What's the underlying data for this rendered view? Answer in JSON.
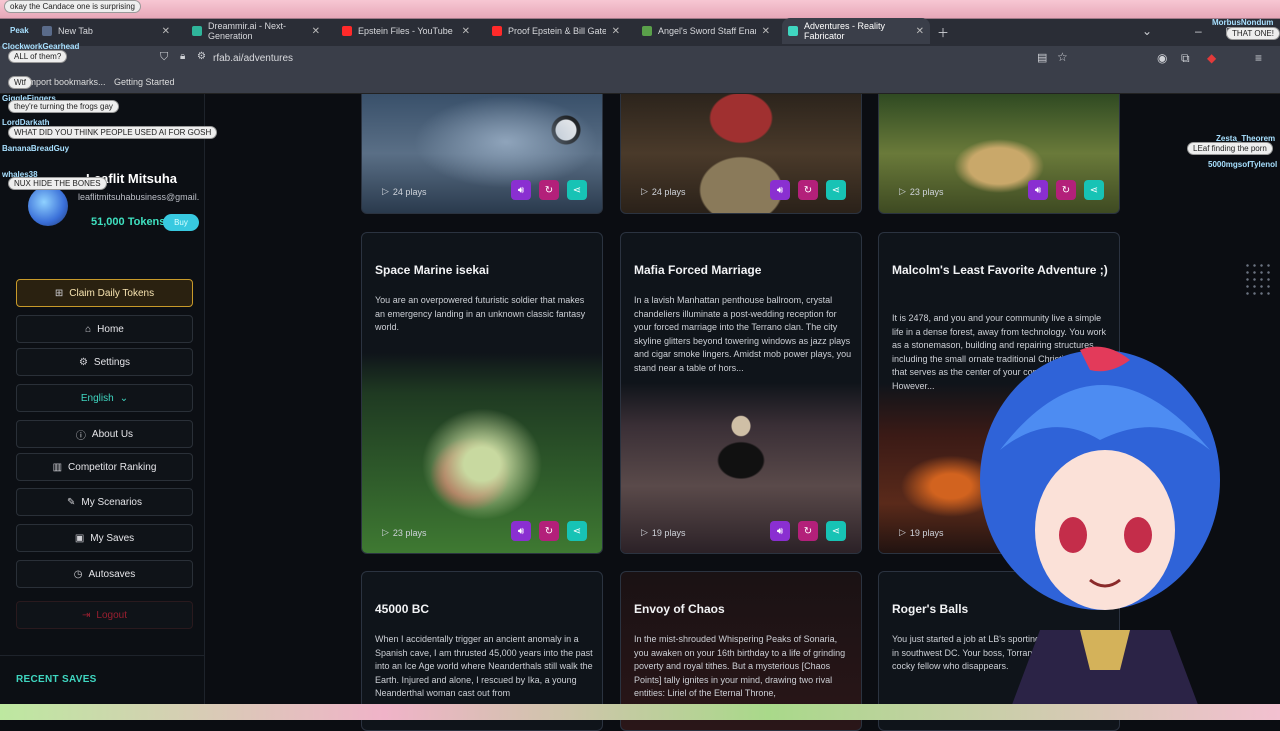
{
  "browser": {
    "tabs": [
      {
        "title": "New Tab",
        "color": "#5a6b8a"
      },
      {
        "title": "Dreammir.ai - Next-Generation",
        "color": "#2fb59b"
      },
      {
        "title": "Epstein Files - YouTube",
        "color": "#ff2a2a"
      },
      {
        "title": "Proof Epstein & Bill Gates creat",
        "color": "#ff2a2a"
      },
      {
        "title": "Angel's Sword Staff Enamel Pin",
        "color": "#5aa04a"
      },
      {
        "title": "Adventures - Reality Fabricator",
        "color": "#3fd6c0"
      }
    ],
    "url": "rfab.ai/adventures",
    "bookmarks": [
      "Import bookmarks...",
      "Getting Started"
    ]
  },
  "sidebar": {
    "username": "Leaflit Mitsuha",
    "email": "leaflitmitsuhabusiness@gmail.",
    "tokens": "51,000 Tokens",
    "buy_label": "Buy",
    "claim_label": "Claim Daily Tokens",
    "menu": {
      "home": "Home",
      "settings": "Settings",
      "language": "English",
      "about": "About Us",
      "ranking": "Competitor Ranking",
      "scenarios": "My Scenarios",
      "saves": "My Saves",
      "autosaves": "Autosaves",
      "logout": "Logout"
    },
    "recent_saves": "RECENT SAVES"
  },
  "top_cards": [
    {
      "plays": "24 plays"
    },
    {
      "plays": "24 plays"
    },
    {
      "plays": "23 plays"
    }
  ],
  "cards": [
    {
      "title": "Space Marine isekai",
      "desc": "You are an overpowered futuristic soldier that makes an emergency landing in an unknown classic fantasy world.",
      "plays": "23 plays"
    },
    {
      "title": "Mafia Forced Marriage",
      "desc": "In a lavish Manhattan penthouse ballroom, crystal chandeliers illuminate a post-wedding reception for your forced marriage into the Terrano clan. The city skyline glitters beyond towering windows as jazz plays and cigar smoke lingers. Amidst mob power plays, you stand near a table of hors...",
      "plays": "19 plays"
    },
    {
      "title": "Malcolm's Least Favorite Adventure ;)",
      "desc": "It is 2478, and you and your community live a simple life in a dense forest, away from technology. You work as a stonemason, building and repairing structures, including the small ornate traditional Christian church that serves as the center of your community. However...",
      "plays": "19 plays"
    },
    {
      "title": "45000 BC",
      "desc": "When I accidentally trigger an ancient anomaly in a Spanish cave, I am thrusted 45,000 years into the past into an Ice Age world where Neanderthals still walk the Earth. Injured and alone, I rescued by Ika, a young Neanderthal woman cast out from"
    },
    {
      "title": "Envoy of Chaos",
      "desc": "In the mist-shrouded Whispering Peaks of Sonaria, you awaken on your 16th birthday to a life of grinding poverty and royal tithes. But a mysterious [Chaos Points] tally ignites in your mind, drawing two rival entities: Liriel of the Eternal Throne,"
    },
    {
      "title": "Roger's Balls",
      "desc": "You just started a job at LB's sporting equipment store in southwest DC. Your boss, Torrance Attleboro, is a cocky fellow who disappears."
    }
  ],
  "chat": [
    {
      "name": "Peak",
      "msg": "okay the Candace one is surprising"
    },
    {
      "name": "ClockworkGearhead",
      "msg": "ALL of them?"
    },
    {
      "name": "Wtf",
      "msg": ""
    },
    {
      "name": "GiggleFingers",
      "msg": "they're turning the frogs gay"
    },
    {
      "name": "LordDarkath",
      "msg": "WHAT DID YOU THINK PEOPLE USED AI FOR GOSH"
    },
    {
      "name": "BananaBreadGuy",
      "msg": ""
    },
    {
      "name": "whales38",
      "msg": "NUX HIDE THE BONES"
    },
    {
      "name": "MorbusNondum",
      "msg": "THAT ONE!"
    },
    {
      "name": "Zesta_Theorem",
      "msg": "LEaf finding the porn"
    },
    {
      "name": "5000mgsofTylenol",
      "msg": ""
    }
  ],
  "colors": {
    "accent": "#3fd6c0",
    "gold": "#c89a2a",
    "purple": "#8a2fd1",
    "magenta": "#b3207a"
  }
}
